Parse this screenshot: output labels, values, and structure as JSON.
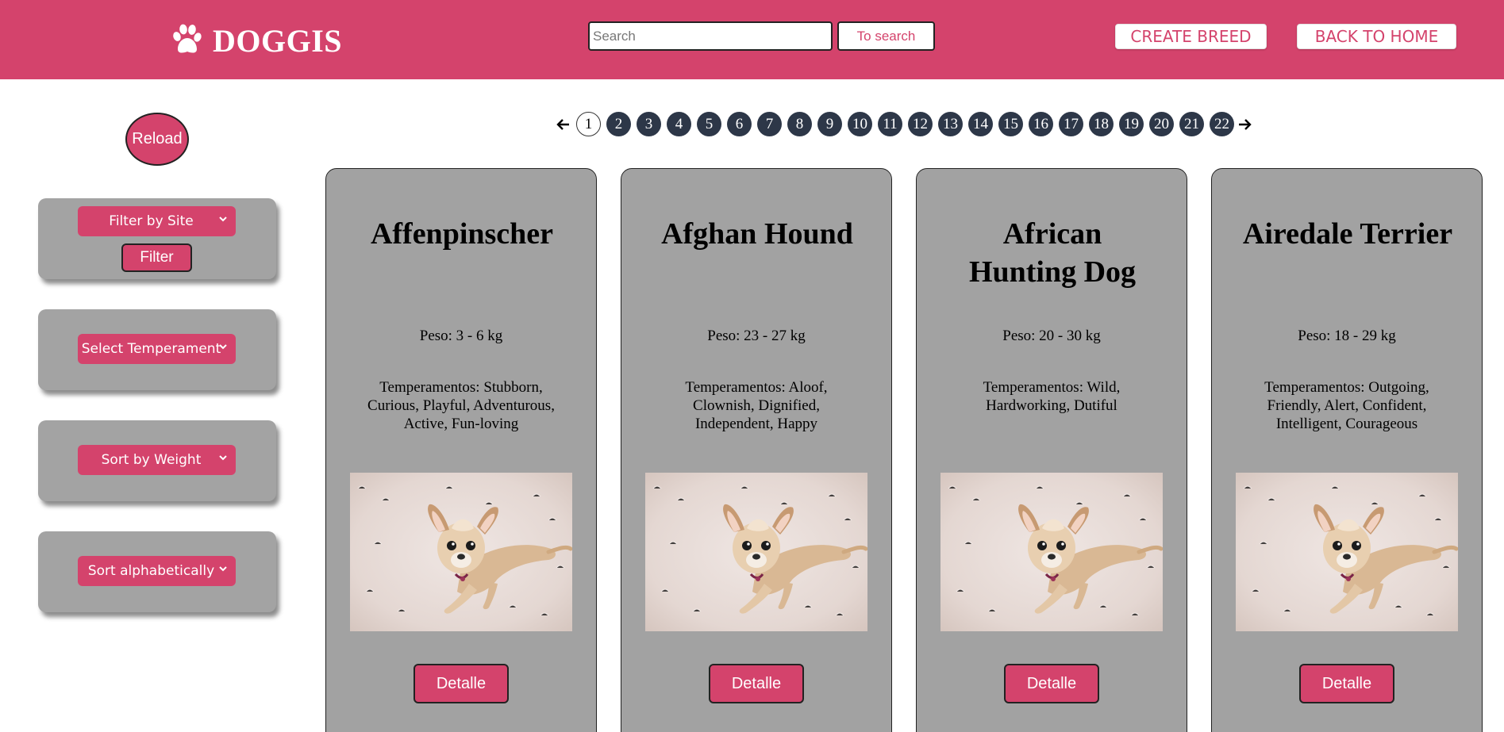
{
  "header": {
    "logo_text": "DOGGIS",
    "search_placeholder": "Search",
    "search_button": "To search",
    "create_button": "CREATE BREED",
    "home_button": "BACK TO HOME"
  },
  "sidebar": {
    "reload_label": "Reload",
    "site_filter_label": "Filter by Site",
    "filter_button": "Filter",
    "temperament_label": "Select Temperament",
    "weight_sort_label": "Sort by Weight",
    "alpha_sort_label": "Sort alphabetically"
  },
  "pagination": {
    "current_page": "1",
    "pages": [
      "1",
      "2",
      "3",
      "4",
      "5",
      "6",
      "7",
      "8",
      "9",
      "10",
      "11",
      "12",
      "13",
      "14",
      "15",
      "16",
      "17",
      "18",
      "19",
      "20",
      "21",
      "22"
    ]
  },
  "cards": [
    {
      "name_line1": "Affenpinscher",
      "name_line2": "",
      "weight": "Peso: 3 - 6 kg",
      "temperaments": "Temperamentos: Stubborn, Curious, Playful, Adventurous, Active, Fun-loving",
      "button": "Detalle"
    },
    {
      "name_line1": "Afghan Hound",
      "name_line2": "",
      "weight": "Peso: 23 - 27 kg",
      "temperaments": "Temperamentos: Aloof, Clownish, Dignified, Independent, Happy",
      "button": "Detalle"
    },
    {
      "name_line1": "African",
      "name_line2": "Hunting Dog",
      "weight": "Peso: 20 - 30 kg",
      "temperaments": "Temperamentos: Wild, Hardworking, Dutiful",
      "button": "Detalle"
    },
    {
      "name_line1": "Airedale Terrier",
      "name_line2": "",
      "weight": "Peso: 18 - 29 kg",
      "temperaments": "Temperamentos: Outgoing, Friendly, Alert, Confident, Intelligent, Courageous",
      "button": "Detalle"
    }
  ],
  "colors": {
    "brand": "#d4436c",
    "card_bg": "#a2a2a2",
    "page_dot": "#2d3748"
  },
  "icons": {
    "logo": "paw-icon",
    "prev": "arrow-left-icon",
    "next": "arrow-right-icon",
    "select": "chevron-down-icon"
  }
}
